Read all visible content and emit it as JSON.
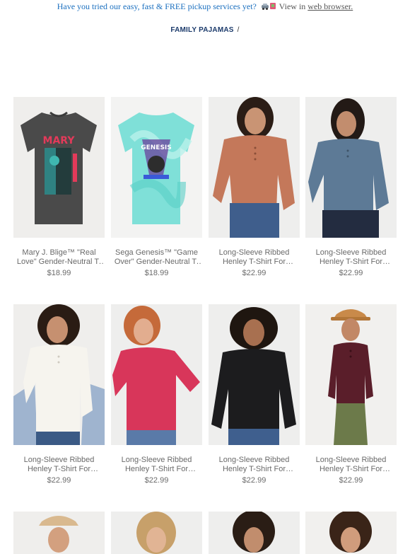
{
  "banner": {
    "text": "Have you tried our easy, fast & FREE pickup services yet?",
    "view_prefix": "View in",
    "link": "web browser."
  },
  "nav": {
    "item": "FAMILY PAJAMAS",
    "separator": "/"
  },
  "products": [
    {
      "name": "Mary J. Blige™ \"Real Love\" Gender-Neutral T-Shirt for Adults",
      "price": "$18.99"
    },
    {
      "name": "Sega Genesis™ \"Game Over\" Gender-Neutral T-Shirt for Adults",
      "price": "$18.99"
    },
    {
      "name": "Long-Sleeve Ribbed Henley T-Shirt For Women",
      "price": "$22.99"
    },
    {
      "name": "Long-Sleeve Ribbed Henley T-Shirt For Women",
      "price": "$22.99"
    },
    {
      "name": "Long-Sleeve Ribbed Henley T-Shirt For Women",
      "price": "$22.99"
    },
    {
      "name": "Long-Sleeve Ribbed Henley T-Shirt For Women",
      "price": "$22.99"
    },
    {
      "name": "Long-Sleeve Ribbed Henley T-Shirt For Women",
      "price": "$22.99"
    },
    {
      "name": "Long-Sleeve Ribbed Henley T-Shirt For Women",
      "price": "$22.99"
    }
  ],
  "graphics": {
    "tee1_title": "MARY",
    "tee2_title": "GENESIS"
  },
  "colors": {
    "banner_link": "#1a6fbf",
    "nav": "#1b3a6b",
    "text_grey": "#6a6a6a"
  }
}
